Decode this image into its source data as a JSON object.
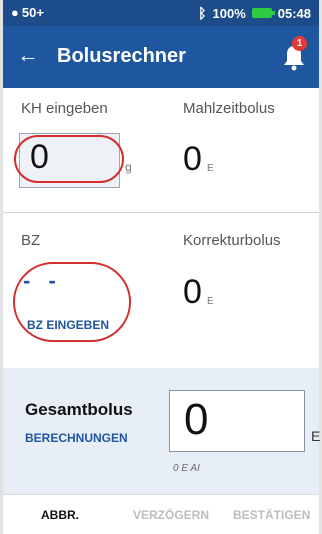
{
  "status_bar": {
    "left_text": "50+",
    "bluetooth": "bluetooth-icon",
    "battery": "100%",
    "time": "05:48"
  },
  "app_bar": {
    "title": "Bolusrechner",
    "notification_count": "1"
  },
  "carbs": {
    "label": "KH eingeben",
    "value": "0",
    "unit": "g"
  },
  "meal_bolus": {
    "label": "Mahlzeitbolus",
    "value": "0",
    "unit": "E"
  },
  "bg": {
    "label": "BZ",
    "value": "- -",
    "action": "BZ EINGEBEN"
  },
  "correction_bolus": {
    "label": "Korrekturbolus",
    "value": "0",
    "unit": "E"
  },
  "total_bolus": {
    "label": "Gesamtbolus",
    "calc_link": "BERECHNUNGEN",
    "value": "0",
    "unit": "E",
    "sub": "0 E AI"
  },
  "footer": {
    "cancel": "ABBR.",
    "delay": "VERZÖGERN",
    "confirm": "BESTÄTIGEN"
  },
  "colors": {
    "status_bar": "#1c4c8a",
    "app_bar": "#1e56a0",
    "accent": "#1e56a0",
    "highlight": "#d32f2f"
  }
}
